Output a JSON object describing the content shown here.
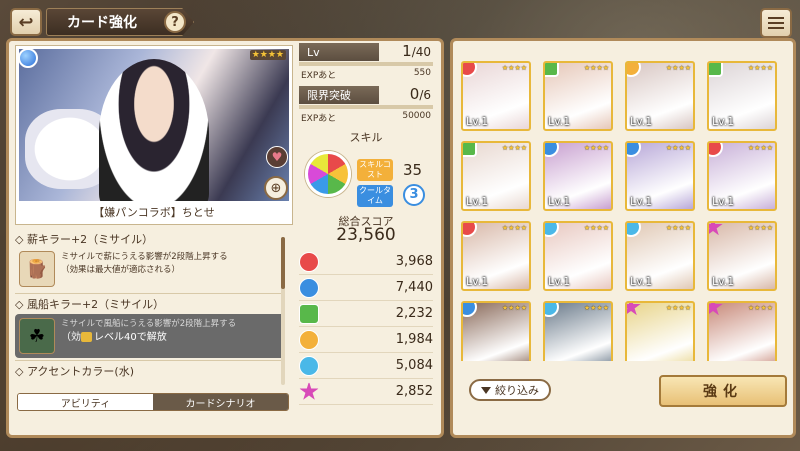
{
  "header": {
    "back_icon": "↩",
    "title": "カード強化",
    "help": "?"
  },
  "card": {
    "name": "【嫌パンコラボ】ちとせ",
    "rarity": "★★★★",
    "element_color": "#2a6ed8"
  },
  "stats": {
    "lv_label": "Lv",
    "lv_value": "1",
    "lv_max": "/40",
    "exp_label": "EXPあと",
    "exp_value": "550",
    "limit_label": "限界突破",
    "limit_value": "0",
    "limit_max": "/6",
    "exp2_label": "EXPあと",
    "exp2_value": "50000"
  },
  "skill": {
    "title": "スキル",
    "cost_label": "スキルコスト",
    "cost_value": "35",
    "cool_label": "クールタイム",
    "cool_value": "3"
  },
  "total": {
    "label": "総合スコア",
    "value": "23,560"
  },
  "scores": [
    {
      "color": "#e84a4a",
      "shape": "circle",
      "value": "3,968"
    },
    {
      "color": "#3a8ee0",
      "shape": "circle",
      "value": "7,440"
    },
    {
      "color": "#58b84a",
      "shape": "sq",
      "value": "2,232"
    },
    {
      "color": "#f3b03a",
      "shape": "circle",
      "value": "1,984"
    },
    {
      "color": "#4ab8e8",
      "shape": "circle",
      "value": "5,084"
    },
    {
      "color": "#d84ab8",
      "shape": "star",
      "value": "2,852"
    }
  ],
  "abilities": [
    {
      "head": "◇ 薪キラー+2（ミサイル）",
      "desc1": "ミサイルで薪にうえる影響が2段階上昇する",
      "desc2": "（効果は最大値が適応される）",
      "icon": "🪵",
      "locked": false
    },
    {
      "head": "◇ 風船キラー+2（ミサイル）",
      "desc1": "ミサイルで風船にうえる影響が2段階上昇する",
      "desc2": "（効",
      "lock_text": "レベル40で解放",
      "icon": "☘",
      "locked": true
    },
    {
      "head": "◇ アクセントカラー(水)"
    }
  ],
  "tabs": {
    "ability": "アビリティ",
    "scenario": "カードシナリオ"
  },
  "grid": {
    "cards": [
      {
        "lv": "Lv.1",
        "el": "#e84a4a",
        "shape": "circle",
        "bg": "#e9d6d6"
      },
      {
        "lv": "Lv.1",
        "el": "#58b84a",
        "shape": "sq",
        "bg": "#e6c7b8"
      },
      {
        "lv": "Lv.1",
        "el": "#f3b03a",
        "shape": "circle",
        "bg": "#d8c6c2"
      },
      {
        "lv": "Lv.1",
        "el": "#58b84a",
        "shape": "sq",
        "bg": "#dcd4d6"
      },
      {
        "lv": "Lv.1",
        "el": "#58b84a",
        "shape": "sq",
        "bg": "#e8d8d0"
      },
      {
        "lv": "Lv.1",
        "el": "#3a8ee0",
        "shape": "circle",
        "bg": "#c8a0d0"
      },
      {
        "lv": "Lv.1",
        "el": "#3a8ee0",
        "shape": "circle",
        "bg": "#b8a8d8"
      },
      {
        "lv": "Lv.1",
        "el": "#e84a4a",
        "shape": "circle",
        "bg": "#c8b0d8"
      },
      {
        "lv": "Lv.1",
        "el": "#e84a4a",
        "shape": "circle",
        "bg": "#d8b8a8"
      },
      {
        "lv": "Lv.1",
        "el": "#4ab8e8",
        "shape": "circle",
        "bg": "#e8c8c0"
      },
      {
        "lv": "Lv.1",
        "el": "#4ab8e8",
        "shape": "circle",
        "bg": "#e0c8b4"
      },
      {
        "lv": "Lv.1",
        "el": "#d84ab8",
        "shape": "star",
        "bg": "#d8b8a8"
      },
      {
        "lv": "",
        "el": "#3a8ee0",
        "shape": "circle",
        "bg": "#8a6a5a"
      },
      {
        "lv": "",
        "el": "#4ab8e8",
        "shape": "circle",
        "bg": "#6a7a8a"
      },
      {
        "lv": "",
        "el": "#d84ab8",
        "shape": "star",
        "bg": "#e8d48a"
      },
      {
        "lv": "",
        "el": "#d84ab8",
        "shape": "star",
        "bg": "#c88a7a"
      }
    ],
    "stars": "★★★★"
  },
  "filter_label": "絞り込み",
  "enhance_label": "強化"
}
